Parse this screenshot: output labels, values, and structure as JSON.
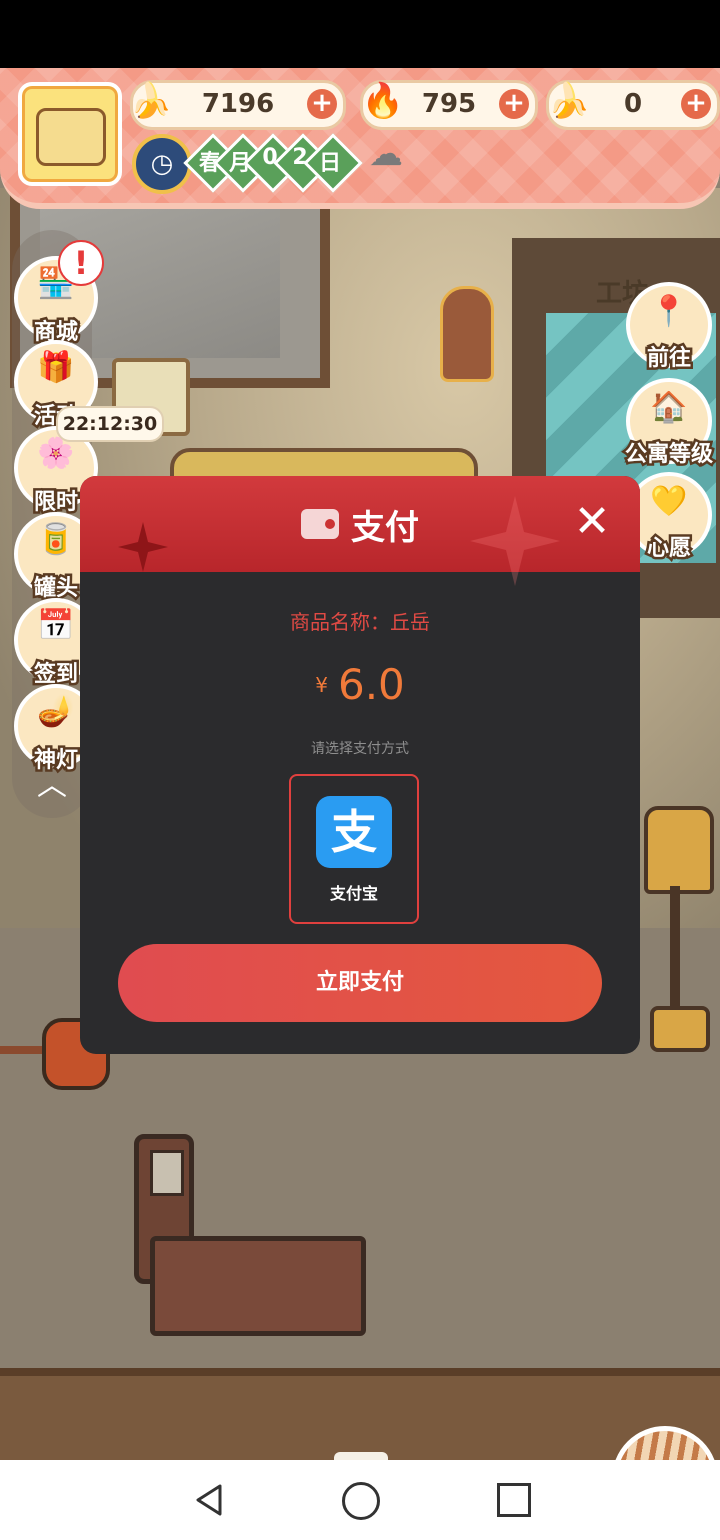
{
  "topbar": {
    "currencies": [
      {
        "icon": "banana-icon",
        "value": "7196"
      },
      {
        "icon": "blue-flame-icon",
        "value": "795"
      },
      {
        "icon": "blue-banana-icon",
        "value": "0"
      }
    ],
    "date": {
      "season": "春",
      "month_label": "月",
      "month_digit": "0",
      "day_digit": "2",
      "day_label": "日"
    },
    "weather_icon": "rain-cloud-icon"
  },
  "scene": {
    "workshop_label": "工坊"
  },
  "left_menu": [
    {
      "label": "商城",
      "glyph": "🏪"
    },
    {
      "label": "活动",
      "glyph": "🎁"
    },
    {
      "label": "限时",
      "glyph": "🌸"
    },
    {
      "label": "罐头",
      "glyph": "🥫"
    },
    {
      "label": "签到",
      "glyph": "📅"
    },
    {
      "label": "神灯",
      "glyph": "🪔"
    }
  ],
  "left_menu_alert": "!",
  "timer": "22:12:30",
  "collapse_glyph": "︿",
  "right_menu": [
    {
      "label": "前往",
      "glyph": "📍"
    },
    {
      "label": "公寓等级",
      "glyph": "🏠"
    },
    {
      "label": "心愿",
      "glyph": "💛"
    }
  ],
  "dialog": {
    "title": "支付",
    "close": "✕",
    "product_line": "商品名称：丘岳",
    "currency_symbol": "¥",
    "amount": "6.0",
    "choose_text": "请选择支付方式",
    "method": {
      "logo": "支",
      "name": "支付宝"
    },
    "pay_button": "立即支付"
  },
  "colors": {
    "accent": "#e04c50",
    "header": "#c32d32",
    "alipay": "#2a9cf2"
  }
}
